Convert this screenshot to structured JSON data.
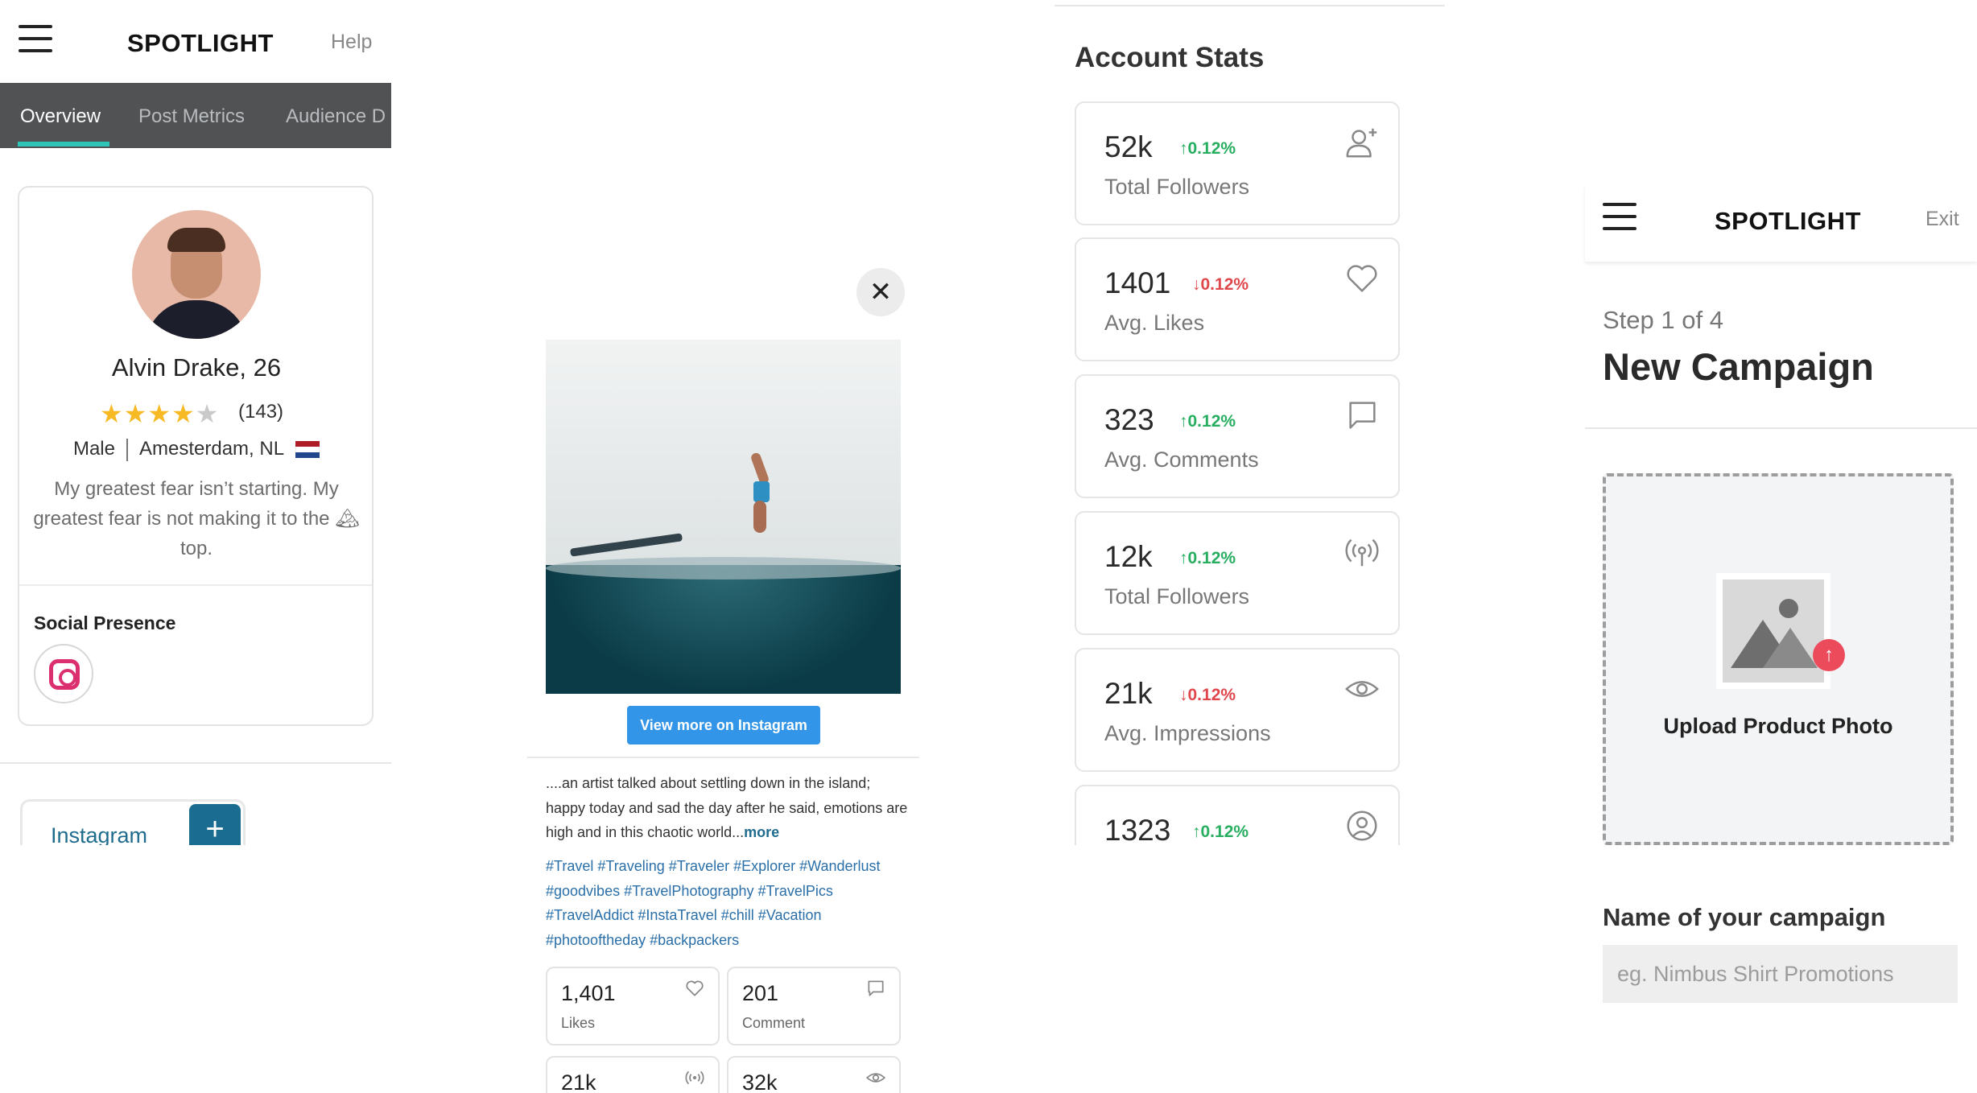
{
  "profile_screen": {
    "brand": "SPOTLIGHT",
    "help_label": "Help",
    "tabs": [
      {
        "label": "Overview",
        "active": true
      },
      {
        "label": "Post Metrics",
        "active": false
      },
      {
        "label": "Audience D",
        "active": false
      }
    ],
    "profile": {
      "name": "Alvin Drake, 26",
      "rating": 4.5,
      "stars": "★★★★★",
      "rating_count": "(143)",
      "gender": "Male",
      "location": "Amesterdam, NL",
      "bio": "My greatest fear isn’t starting. My greatest fear is not making it to the 🏔top."
    },
    "social": {
      "title": "Social Presence",
      "icon": "instagram-icon"
    },
    "platform_chip": {
      "label": "Instagram",
      "add_label": "+"
    }
  },
  "post_screen": {
    "close_label": "✕",
    "view_button": "View more on Instagram",
    "caption": "....an artist talked about settling down in the island; happy today and sad the day after he said, emotions are high and in this chaotic world...",
    "more_label": "more",
    "hashtags": "#Travel #Traveling #Traveler #Explorer #Wanderlust #goodvibes #TravelPhotography #TravelPics #TravelAddict #InstaTravel #chill #Vacation #photooftheday #backpackers",
    "stats": [
      {
        "value": "1,401",
        "label": "Likes",
        "icon": "heart-icon"
      },
      {
        "value": "201",
        "label": "Comment",
        "icon": "comment-icon"
      },
      {
        "value": "21k",
        "label": "",
        "icon": "broadcast-icon"
      },
      {
        "value": "32k",
        "label": "",
        "icon": "eye-icon"
      }
    ]
  },
  "stats_screen": {
    "title": "Account Stats",
    "cards": [
      {
        "value": "52k",
        "change": "0.12%",
        "direction": "up",
        "label": "Total Followers",
        "icon": "add-user-icon"
      },
      {
        "value": "1401",
        "change": "0.12%",
        "direction": "down",
        "label": "Avg. Likes",
        "icon": "heart-icon"
      },
      {
        "value": "323",
        "change": "0.12%",
        "direction": "up",
        "label": "Avg. Comments",
        "icon": "comment-icon"
      },
      {
        "value": "12k",
        "change": "0.12%",
        "direction": "up",
        "label": "Total Followers",
        "icon": "broadcast-icon"
      },
      {
        "value": "21k",
        "change": "0.12%",
        "direction": "down",
        "label": "Avg. Impressions",
        "icon": "eye-icon"
      },
      {
        "value": "1323",
        "change": "0.12%",
        "direction": "up",
        "label": "",
        "icon": "user-circle-icon"
      }
    ],
    "colors": {
      "up": "#27ae60",
      "down": "#e0474c"
    }
  },
  "campaign_screen": {
    "brand": "SPOTLIGHT",
    "exit_label": "Exit",
    "step": "Step 1 of 4",
    "title": "New Campaign",
    "upload_label": "Upload Product Photo",
    "name_label": "Name of your campaign",
    "name_placeholder": "eg. Nimbus Shirt Promotions",
    "name_value": ""
  }
}
